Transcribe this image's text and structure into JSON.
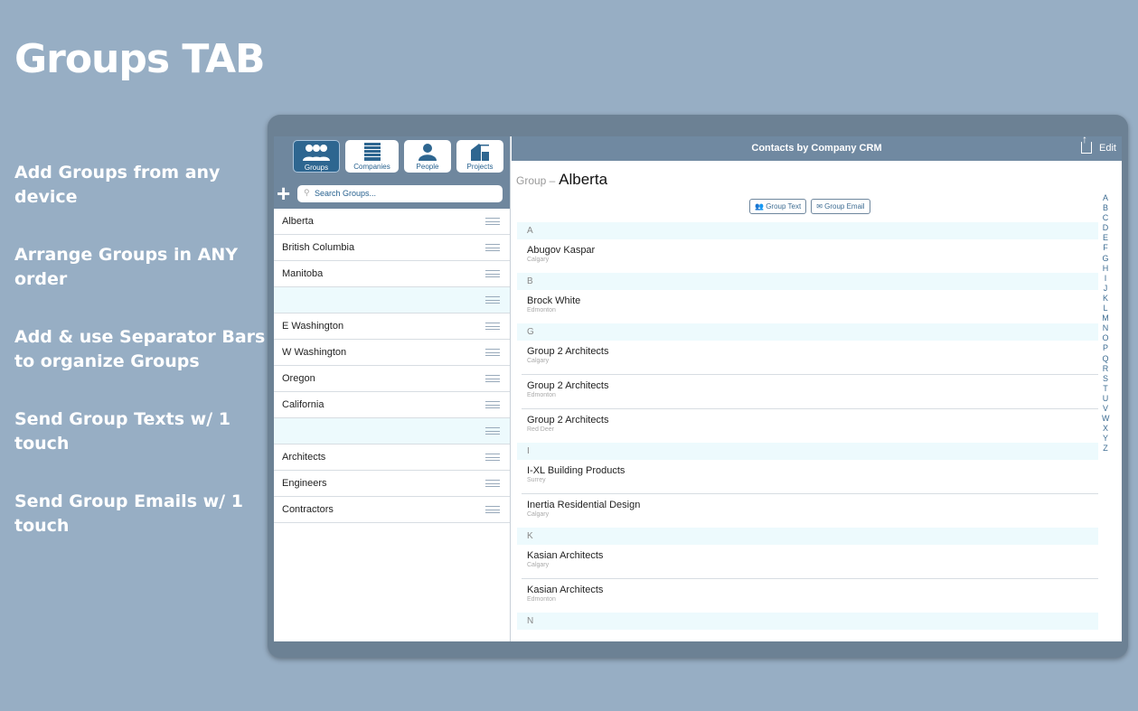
{
  "slide": {
    "title": "Groups TAB",
    "bullets": [
      "Add Groups from any device",
      "Arrange Groups in ANY order",
      "Add & use Separator Bars to organize Groups",
      "Send Group Texts w/ 1 touch",
      "Send Group Emails w/ 1 touch"
    ]
  },
  "tabs": [
    {
      "label": "Groups"
    },
    {
      "label": "Companies"
    },
    {
      "label": "People"
    },
    {
      "label": "Projects"
    }
  ],
  "add_label": "+",
  "search": {
    "placeholder": "Search Groups..."
  },
  "groups": [
    "Alberta",
    "British Columbia",
    "Manitoba",
    "",
    "E Washington",
    "W Washington",
    "Oregon",
    "California",
    "",
    "Architects",
    "Engineers",
    "Contractors"
  ],
  "header": {
    "title": "Contacts by Company CRM",
    "edit": "Edit"
  },
  "group": {
    "prefix": "Group –",
    "name": "Alberta"
  },
  "buttons": {
    "text": "Group Text",
    "email": "Group Email"
  },
  "sections": [
    {
      "letter": "A",
      "contacts": [
        {
          "name": "Abugov Kaspar",
          "city": "Calgary"
        }
      ]
    },
    {
      "letter": "B",
      "contacts": [
        {
          "name": "Brock White",
          "city": "Edmonton"
        }
      ]
    },
    {
      "letter": "G",
      "contacts": [
        {
          "name": "Group 2 Architects",
          "city": "Calgary"
        },
        {
          "name": "Group 2 Architects",
          "city": "Edmonton"
        },
        {
          "name": "Group 2 Architects",
          "city": "Red Deer"
        }
      ]
    },
    {
      "letter": "I",
      "contacts": [
        {
          "name": "I-XL Building Products",
          "city": "Surrey"
        },
        {
          "name": "Inertia Residential Design",
          "city": "Calgary"
        }
      ]
    },
    {
      "letter": "K",
      "contacts": [
        {
          "name": "Kasian Architects",
          "city": "Calgary"
        },
        {
          "name": "Kasian Architects",
          "city": "Edmonton"
        }
      ]
    },
    {
      "letter": "N",
      "contacts": []
    }
  ],
  "index": [
    "A",
    "B",
    "C",
    "D",
    "E",
    "F",
    "G",
    "H",
    "I",
    "J",
    "K",
    "L",
    "M",
    "N",
    "O",
    "P",
    "Q",
    "R",
    "S",
    "T",
    "U",
    "V",
    "W",
    "X",
    "Y",
    "Z"
  ]
}
